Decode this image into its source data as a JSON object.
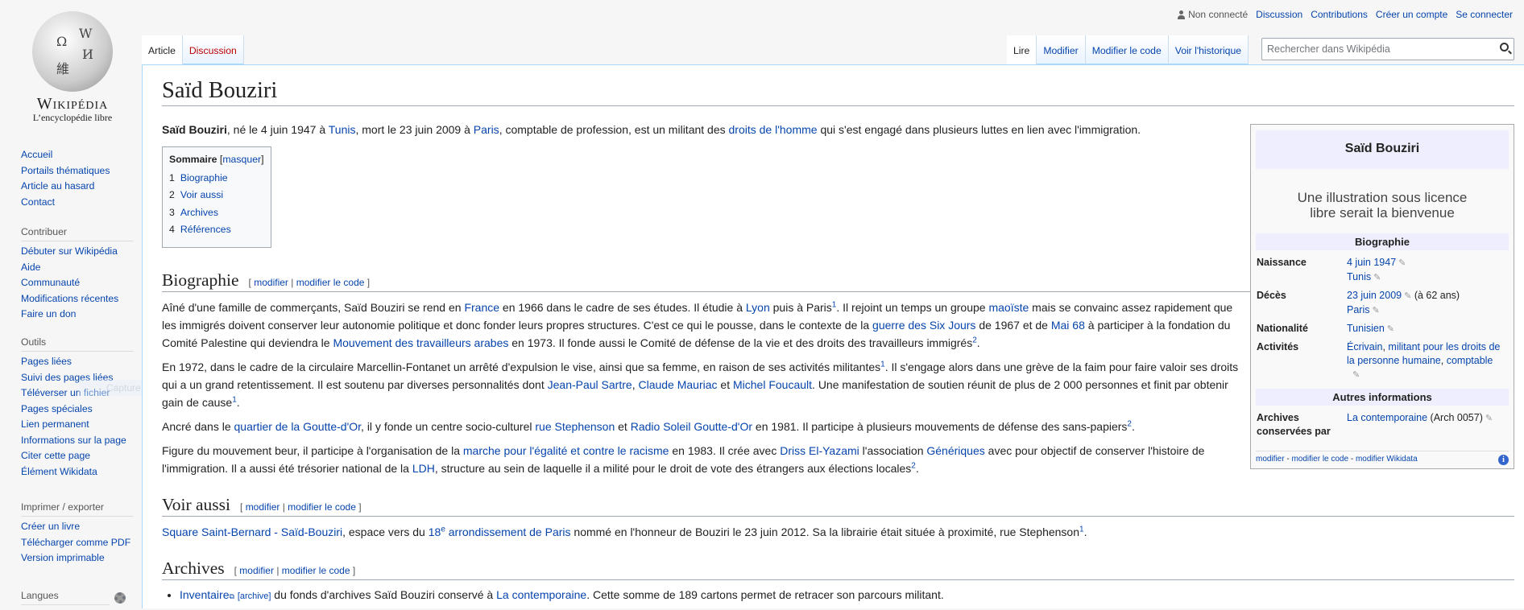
{
  "logo": {
    "wordmark": "Wikipédia",
    "tagline": "L’encyclopédie libre"
  },
  "sidebar": {
    "nav": [
      "Accueil",
      "Portails thématiques",
      "Article au hasard",
      "Contact"
    ],
    "portals": [
      {
        "title": "Contribuer",
        "items": [
          "Débuter sur Wikipédia",
          "Aide",
          "Communauté",
          "Modifications récentes",
          "Faire un don"
        ]
      },
      {
        "title": "Outils",
        "items": [
          "Pages liées",
          "Suivi des pages liées",
          "Téléverser un fichier",
          "Pages spéciales",
          "Lien permanent",
          "Informations sur la page",
          "Citer cette page",
          "Élément Wikidata"
        ]
      },
      {
        "title": "Imprimer / exporter",
        "items": [
          "Créer un livre",
          "Télécharger comme PDF",
          "Version imprimable"
        ]
      },
      {
        "title": "Langues",
        "items": []
      }
    ]
  },
  "overlay": {
    "capture": "Capture Fenêtre"
  },
  "personal": {
    "anon": "Non connecté",
    "links": [
      "Discussion",
      "Contributions",
      "Créer un compte",
      "Se connecter"
    ]
  },
  "tabs": {
    "left": [
      "Article",
      "Discussion"
    ],
    "right": [
      "Lire",
      "Modifier",
      "Modifier le code",
      "Voir l'historique"
    ]
  },
  "search": {
    "placeholder": "Rechercher dans Wikipédia"
  },
  "article": {
    "title": "Saïd Bouziri",
    "lead": [
      {
        "b": "Saïd Bouziri"
      },
      {
        "t": ", né le 4 juin 1947 à "
      },
      {
        "l": "Tunis"
      },
      {
        "t": ", mort le 23 juin 2009 à "
      },
      {
        "l": "Paris"
      },
      {
        "t": ", comptable de profession, est un militant des "
      },
      {
        "l": "droits de l'homme"
      },
      {
        "t": " qui s'est engagé dans plusieurs luttes en lien avec l'immigration."
      }
    ],
    "toc": {
      "title": "Sommaire",
      "toggle": "masquer",
      "items": [
        {
          "n": "1",
          "label": "Biographie"
        },
        {
          "n": "2",
          "label": "Voir aussi"
        },
        {
          "n": "3",
          "label": "Archives"
        },
        {
          "n": "4",
          "label": "Références"
        }
      ]
    },
    "edit": {
      "modifier": "modifier",
      "code": "modifier le code"
    },
    "sections": [
      {
        "title": "Biographie",
        "paras": [
          [
            {
              "t": "Aîné d'une famille de commerçants, Saïd Bouziri se rend en "
            },
            {
              "l": "France"
            },
            {
              "t": " en 1966 dans le cadre de ses études. Il étudie à "
            },
            {
              "l": "Lyon"
            },
            {
              "t": " puis à Paris"
            },
            {
              "s": "1"
            },
            {
              "t": ". Il rejoint un temps un groupe "
            },
            {
              "l": "maoïste"
            },
            {
              "t": " mais se convainc assez rapidement que les immigrés doivent conserver leur autonomie politique et donc fonder leurs propres structures. C'est ce qui le pousse, dans le contexte de la "
            },
            {
              "l": "guerre des Six Jours"
            },
            {
              "t": " de 1967 et de "
            },
            {
              "l": "Mai 68"
            },
            {
              "t": " à participer à la fondation du Comité Palestine qui deviendra le "
            },
            {
              "l": "Mouvement des travailleurs arabes"
            },
            {
              "t": " en 1973. Il fonde aussi le Comité de défense de la vie et des droits des travailleurs immigrés"
            },
            {
              "s": "2"
            },
            {
              "t": "."
            }
          ],
          [
            {
              "t": "En 1972, dans le cadre de la circulaire Marcellin-Fontanet un arrêté d'expulsion le vise, ainsi que sa femme, en raison de ses activités militantes"
            },
            {
              "s": "1"
            },
            {
              "t": ". Il s'engage alors dans une grève de la faim pour faire valoir ses droits qui a un grand retentissement. Il est soutenu par diverses personnalités dont "
            },
            {
              "l": "Jean-Paul Sartre"
            },
            {
              "t": ", "
            },
            {
              "l": "Claude Mauriac"
            },
            {
              "t": " et "
            },
            {
              "l": "Michel Foucault"
            },
            {
              "t": ". Une manifestation de soutien réunit de plus de 2 000 personnes et finit par obtenir gain de cause"
            },
            {
              "s": "1"
            },
            {
              "t": "."
            }
          ],
          [
            {
              "t": "Ancré dans le "
            },
            {
              "l": "quartier de la Goutte-d'Or"
            },
            {
              "t": ", il y fonde un centre socio-culturel "
            },
            {
              "l": "rue Stephenson"
            },
            {
              "t": " et "
            },
            {
              "l": "Radio Soleil Goutte-d'Or"
            },
            {
              "t": " en 1981. Il participe à plusieurs mouvements de défense des sans-papiers"
            },
            {
              "s": "2"
            },
            {
              "t": "."
            }
          ],
          [
            {
              "t": "Figure du mouvement beur, il participe à l'organisation de la "
            },
            {
              "l": "marche pour l'égalité et contre le racisme"
            },
            {
              "t": " en 1983. Il crée avec "
            },
            {
              "l": "Driss El-Yazami"
            },
            {
              "t": " l'association "
            },
            {
              "l": "Génériques"
            },
            {
              "t": " avec pour objectif de conserver l'histoire de l'immigration. Il a aussi été trésorier national de la "
            },
            {
              "l": "LDH"
            },
            {
              "t": ", structure au sein de laquelle il a milité pour le droit de vote des étrangers aux élections locales"
            },
            {
              "s": "2"
            },
            {
              "t": "."
            }
          ]
        ]
      },
      {
        "title": "Voir aussi",
        "paras": [
          [
            {
              "l": "Square Saint-Bernard - Saïd-Bouziri"
            },
            {
              "t": ", espace vers du "
            },
            {
              "l": "18"
            },
            {
              "ls": "e"
            },
            {
              "l": " arrondissement de Paris"
            },
            {
              "t": " nommé en l'honneur de Bouziri le 23 juin 2012. Sa la librairie était située à proximité, rue Stephenson"
            },
            {
              "s": "1"
            },
            {
              "t": "."
            }
          ]
        ]
      },
      {
        "title": "Archives",
        "bullets": [
          [
            {
              "l": "Inventaire"
            },
            {
              "ext": "⧉"
            },
            {
              "t": " "
            },
            {
              "la": "[archive]"
            },
            {
              "t": " du fonds d'archives Saïd Bouziri conservé à "
            },
            {
              "l": "La contemporaine"
            },
            {
              "t": ". Cette somme de 189 cartons permet de retracer son parcours militant."
            }
          ]
        ]
      }
    ]
  },
  "infobox": {
    "title": "Saïd Bouziri",
    "illustration": "Une illustration sous licence libre serait la bienvenue",
    "sections": [
      {
        "title": "Biographie",
        "rows": [
          {
            "k": "Naissance",
            "v": [
              [
                {
                  "l": "4 juin 1947"
                },
                {
                  "p": 1
                }
              ],
              [
                {
                  "l": "Tunis"
                },
                {
                  "p": 1
                }
              ]
            ]
          },
          {
            "k": "Décès",
            "v": [
              [
                {
                  "l": "23 juin 2009"
                },
                {
                  "p": 1
                },
                {
                  "t": " (à 62 ans)"
                }
              ],
              [
                {
                  "l": "Paris"
                },
                {
                  "p": 1
                }
              ]
            ]
          },
          {
            "k": "Nationalité",
            "v": [
              [
                {
                  "l": "Tunisien"
                },
                {
                  "p": 1
                }
              ]
            ]
          },
          {
            "k": "Activités",
            "v": [
              [
                {
                  "l": "Écrivain"
                },
                {
                  "t": ", "
                },
                {
                  "l": "militant pour les droits de la personne humaine"
                },
                {
                  "t": ", "
                },
                {
                  "l": "comptable"
                }
              ],
              [
                {
                  "p": 1
                }
              ]
            ]
          }
        ]
      },
      {
        "title": "Autres informations",
        "rows": [
          {
            "k": "Archives conservées par",
            "v": [
              [
                {
                  "l": "La contemporaine"
                },
                {
                  "t": " (Arch 0057)"
                },
                {
                  "p": 1
                }
              ]
            ]
          }
        ]
      }
    ],
    "footer": [
      "modifier",
      "modifier le code",
      "modifier Wikidata"
    ],
    "footer_sep": " - "
  },
  "colors": {
    "link": "#0645ad",
    "sidebar_bg": "#f6f6f6",
    "infobox_header": "#eeeefe",
    "tab_border": "#a7d7f9"
  }
}
